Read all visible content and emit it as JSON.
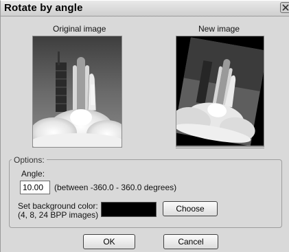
{
  "window": {
    "title": "Rotate by angle"
  },
  "images": {
    "original_label": "Original image",
    "new_label": "New image"
  },
  "options": {
    "group_label": "Options:",
    "angle_label": "Angle:",
    "angle_value": "10.00",
    "angle_hint": "(between -360.0  -  360.0 degrees)",
    "bg_color_label_line1": "Set background color:",
    "bg_color_label_line2": "(4, 8, 24 BPP images)",
    "bg_color": "#000000",
    "choose_label": "Choose"
  },
  "buttons": {
    "ok": "OK",
    "cancel": "Cancel"
  },
  "icons": {
    "close": "close-icon"
  }
}
